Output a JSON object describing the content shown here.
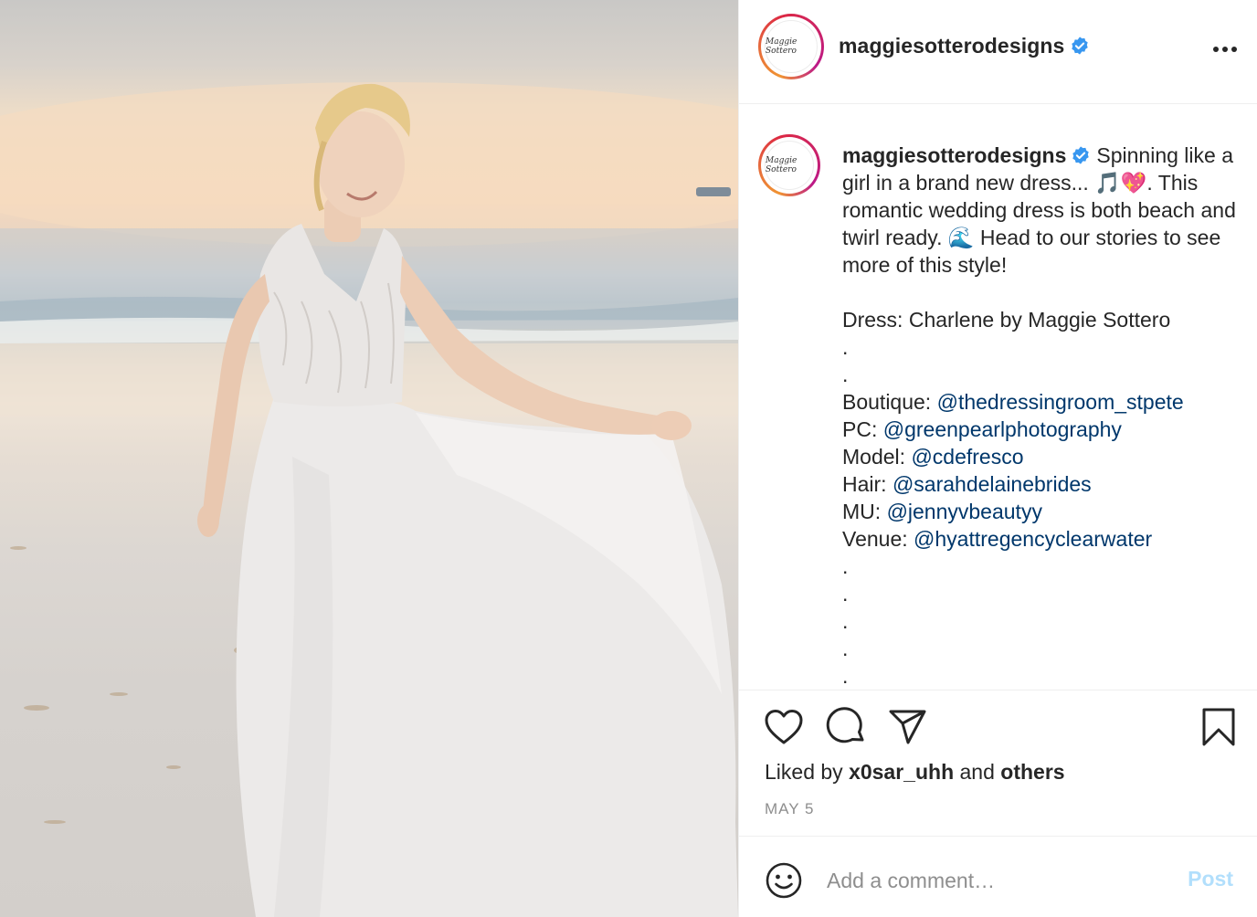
{
  "post": {
    "username": "maggiesotterodesigns",
    "avatar_text": "Maggie Sottero",
    "verified_icon": "verified-badge-icon",
    "accent_color": "#3897f0",
    "caption": {
      "intro": "Spinning like a girl in a brand new dress... 🎵💖. This romantic wedding dress is both beach and twirl ready. 🌊 Head to our stories to see more of this style!",
      "dress_line": "Dress: Charlene by Maggie Sottero",
      "dots_a": ".\n.",
      "credits": [
        {
          "label": "Boutique: ",
          "handle": "@thedressingroom_stpete"
        },
        {
          "label": "PC: ",
          "handle": "@greenpearlphotography"
        },
        {
          "label": "Model: ",
          "handle": "@cdefresco"
        },
        {
          "label": "Hair: ",
          "handle": "@sarahdelainebrides"
        },
        {
          "label": "MU: ",
          "handle": "@jennyvbeautyy"
        },
        {
          "label": "Venue: ",
          "handle": "@hyattregencyclearwater"
        }
      ],
      "dots_b": ".\n.\n.\n.\n."
    },
    "likes": {
      "prefix": "Liked by ",
      "user": "x0sar_uhh",
      "middle": " and ",
      "others": "others"
    },
    "date": "MAY 5",
    "comment": {
      "placeholder": "Add a comment…",
      "post_label": "Post",
      "post_color": "#b2dffc"
    },
    "icons": [
      "more-options-icon",
      "heart-icon",
      "comment-icon",
      "share-icon",
      "bookmark-icon",
      "emoji-icon"
    ]
  }
}
